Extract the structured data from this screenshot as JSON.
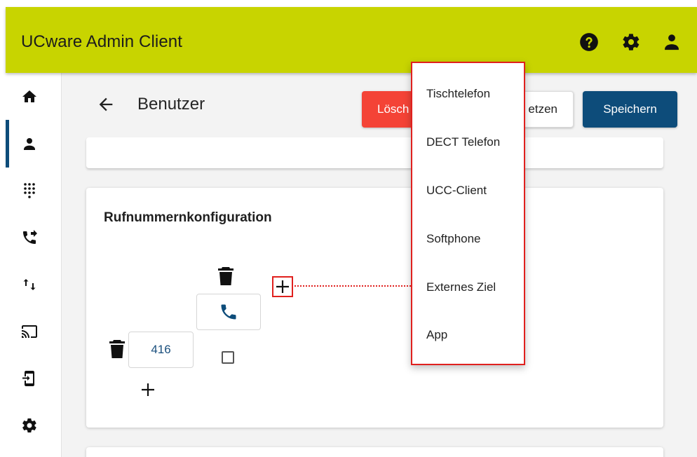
{
  "app": {
    "title": "UCware Admin Client"
  },
  "header": {
    "icons": [
      "help-icon",
      "settings-icon",
      "account-icon"
    ]
  },
  "sidebar": {
    "items": [
      {
        "icon": "home-icon",
        "active": false
      },
      {
        "icon": "user-icon",
        "active": true
      },
      {
        "icon": "dialpad-icon",
        "active": false
      },
      {
        "icon": "phone-forward-icon",
        "active": false
      },
      {
        "icon": "swap-arrows-icon",
        "active": false
      },
      {
        "icon": "cast-icon",
        "active": false
      },
      {
        "icon": "device-login-icon",
        "active": false
      },
      {
        "icon": "settings-icon",
        "active": false
      }
    ]
  },
  "page": {
    "title": "Benutzer",
    "back_icon": "arrow-left-icon"
  },
  "toolbar": {
    "delete_label": "Lösch",
    "reset_label": "etzen",
    "save_label": "Speichern"
  },
  "card": {
    "title": "Rufnummernkonfiguration",
    "number_value": "416"
  },
  "menu": {
    "items": [
      "Tischtelefon",
      "DECT Telefon",
      "UCC-Client",
      "Softphone",
      "Externes Ziel",
      "App"
    ]
  },
  "colors": {
    "header_bg": "#c8d400",
    "primary": "#0d4c7a",
    "danger": "#f44336",
    "highlight": "#e0201e"
  }
}
